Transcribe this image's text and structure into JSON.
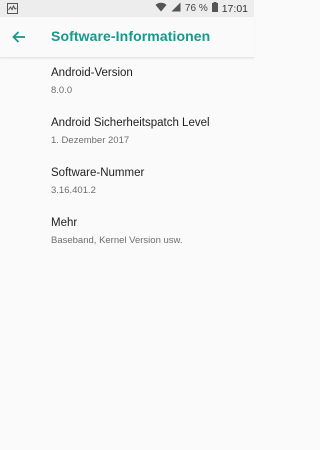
{
  "status_bar": {
    "battery_percent": "76 %",
    "time": "17:01",
    "icons": [
      "activity-icon",
      "wifi-icon",
      "signal-icon",
      "battery-icon"
    ]
  },
  "app_bar": {
    "title": "Software-Informationen",
    "accent_color": "#149a8b"
  },
  "items": [
    {
      "title": "Android-Version",
      "subtitle": "8.0.0"
    },
    {
      "title": "Android Sicherheitspatch Level",
      "subtitle": "1. Dezember 2017"
    },
    {
      "title": "Software-Nummer",
      "subtitle": "3.16.401.2"
    },
    {
      "title": "Mehr",
      "subtitle": "Baseband, Kernel Version usw."
    }
  ]
}
